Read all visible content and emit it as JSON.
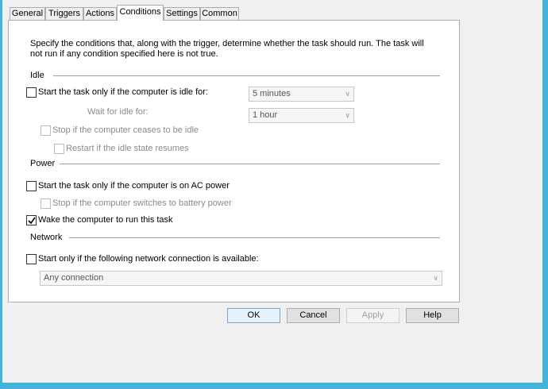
{
  "tabs": [
    "General",
    "Triggers",
    "Actions",
    "Conditions",
    "Settings",
    "Common"
  ],
  "selected_tab": "Conditions",
  "description": "Specify the conditions that, along with the trigger, determine whether the task should run. The task will not run if any condition specified here is not true.",
  "idle": {
    "heading": "Idle",
    "start_if_idle": "Start the task only if the computer is idle for:",
    "idle_duration": "5 minutes",
    "wait_label": "Wait for idle for:",
    "wait_duration": "1 hour",
    "stop_if_ceases": "Stop if the computer ceases to be idle",
    "restart_if_resumes": "Restart if the idle state resumes"
  },
  "power": {
    "heading": "Power",
    "ac_power": "Start the task only if the computer is on AC power",
    "stop_battery": "Stop if the computer switches to battery power",
    "wake": "Wake the computer to run this task",
    "wake_checked": true
  },
  "network": {
    "heading": "Network",
    "start_if_network": "Start only if the following network connection is available:",
    "connection": "Any connection"
  },
  "buttons": {
    "ok": "OK",
    "cancel": "Cancel",
    "apply": "Apply",
    "help": "Help"
  }
}
